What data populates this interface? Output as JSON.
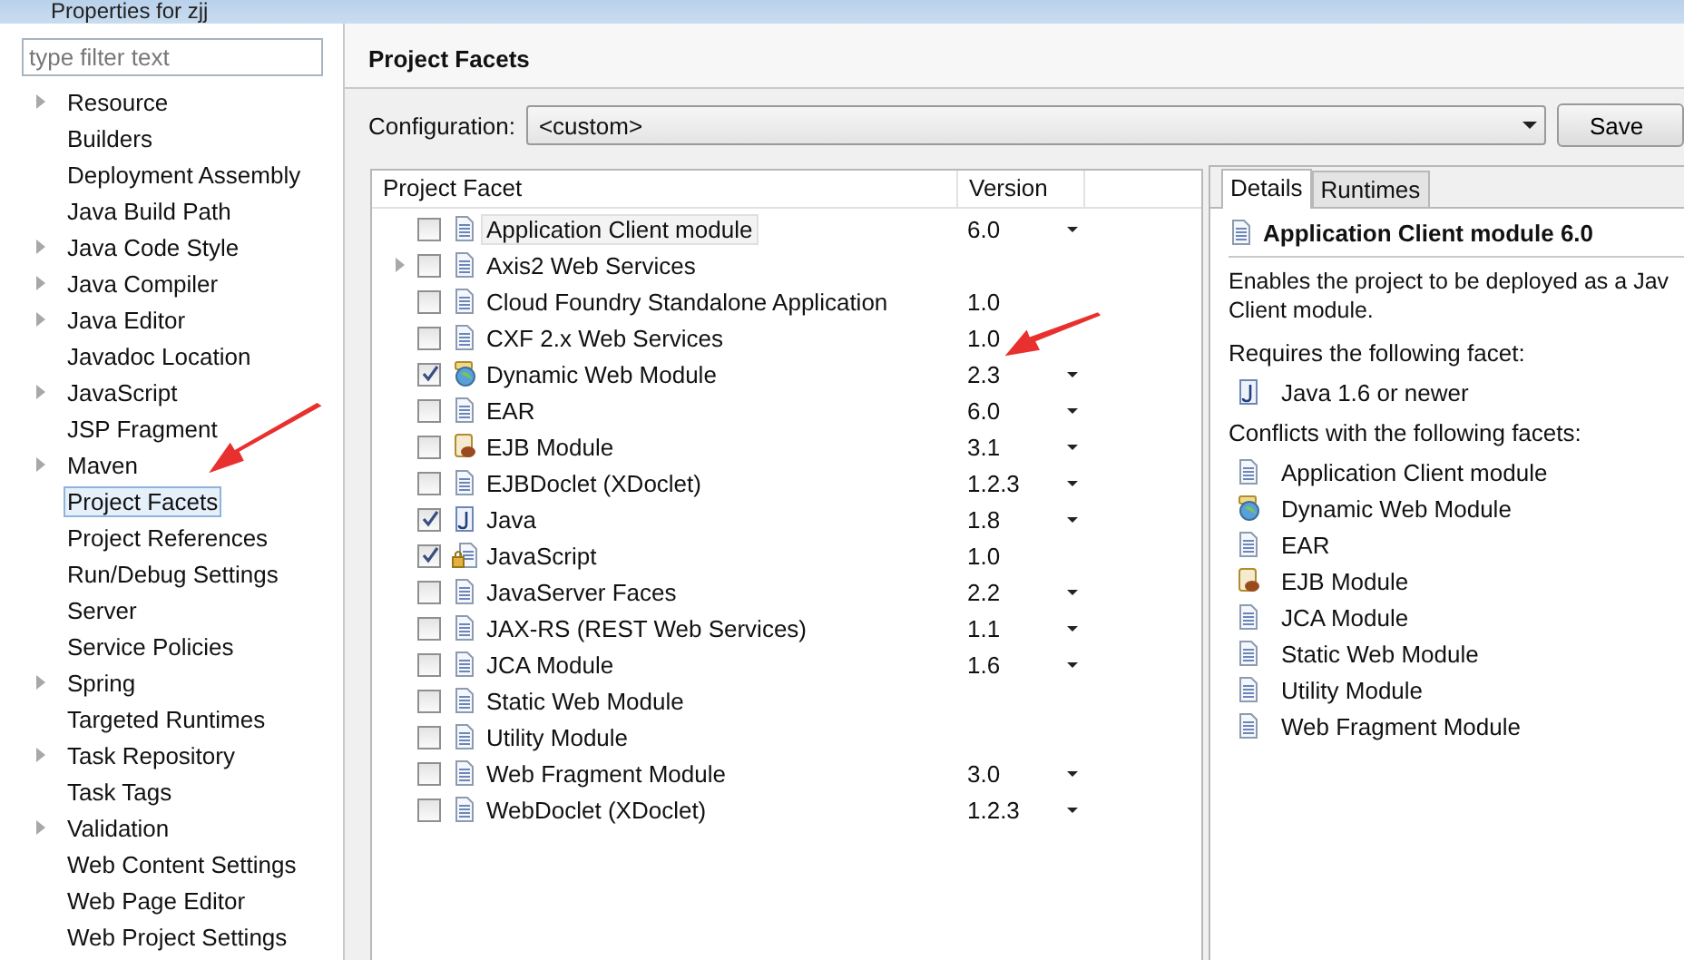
{
  "window": {
    "title": "Properties for zjj"
  },
  "sidebar": {
    "filter": {
      "placeholder": "type filter text"
    },
    "items": [
      {
        "label": "Resource",
        "expandable": true,
        "selected": false
      },
      {
        "label": "Builders",
        "expandable": false,
        "selected": false
      },
      {
        "label": "Deployment Assembly",
        "expandable": false,
        "selected": false
      },
      {
        "label": "Java Build Path",
        "expandable": false,
        "selected": false
      },
      {
        "label": "Java Code Style",
        "expandable": true,
        "selected": false
      },
      {
        "label": "Java Compiler",
        "expandable": true,
        "selected": false
      },
      {
        "label": "Java Editor",
        "expandable": true,
        "selected": false
      },
      {
        "label": "Javadoc Location",
        "expandable": false,
        "selected": false
      },
      {
        "label": "JavaScript",
        "expandable": true,
        "selected": false
      },
      {
        "label": "JSP Fragment",
        "expandable": false,
        "selected": false
      },
      {
        "label": "Maven",
        "expandable": true,
        "selected": false
      },
      {
        "label": "Project Facets",
        "expandable": false,
        "selected": true
      },
      {
        "label": "Project References",
        "expandable": false,
        "selected": false
      },
      {
        "label": "Run/Debug Settings",
        "expandable": false,
        "selected": false
      },
      {
        "label": "Server",
        "expandable": false,
        "selected": false
      },
      {
        "label": "Service Policies",
        "expandable": false,
        "selected": false
      },
      {
        "label": "Spring",
        "expandable": true,
        "selected": false
      },
      {
        "label": "Targeted Runtimes",
        "expandable": false,
        "selected": false
      },
      {
        "label": "Task Repository",
        "expandable": true,
        "selected": false
      },
      {
        "label": "Task Tags",
        "expandable": false,
        "selected": false
      },
      {
        "label": "Validation",
        "expandable": true,
        "selected": false
      },
      {
        "label": "Web Content Settings",
        "expandable": false,
        "selected": false
      },
      {
        "label": "Web Page Editor",
        "expandable": false,
        "selected": false
      },
      {
        "label": "Web Project Settings",
        "expandable": false,
        "selected": false
      }
    ]
  },
  "page": {
    "title": "Project Facets",
    "configuration": {
      "label": "Configuration:",
      "value": "<custom>"
    },
    "save_button": "Save"
  },
  "facets": {
    "columns": [
      "Project Facet",
      "Version"
    ],
    "rows": [
      {
        "name": "Application Client module",
        "version": "6.0",
        "has_menu": true,
        "checked": false,
        "selected": true,
        "expandable": false,
        "kind": "doc"
      },
      {
        "name": "Axis2 Web Services",
        "has_menu": false,
        "checked": false,
        "selected": false,
        "expandable": true,
        "kind": "doc"
      },
      {
        "name": "Cloud Foundry Standalone Application",
        "version": "1.0",
        "has_menu": false,
        "checked": false,
        "selected": false,
        "expandable": false,
        "kind": "doc"
      },
      {
        "name": "CXF 2.x Web Services",
        "version": "1.0",
        "has_menu": false,
        "checked": false,
        "selected": false,
        "expandable": false,
        "kind": "doc"
      },
      {
        "name": "Dynamic Web Module",
        "version": "2.3",
        "has_menu": true,
        "checked": true,
        "selected": false,
        "expandable": false,
        "kind": "web"
      },
      {
        "name": "EAR",
        "version": "6.0",
        "has_menu": true,
        "checked": false,
        "selected": false,
        "expandable": false,
        "kind": "doc"
      },
      {
        "name": "EJB Module",
        "version": "3.1",
        "has_menu": true,
        "checked": false,
        "selected": false,
        "expandable": false,
        "kind": "ejb"
      },
      {
        "name": "EJBDoclet (XDoclet)",
        "version": "1.2.3",
        "has_menu": true,
        "checked": false,
        "selected": false,
        "expandable": false,
        "kind": "doc"
      },
      {
        "name": "Java",
        "version": "1.8",
        "has_menu": true,
        "checked": true,
        "selected": false,
        "expandable": false,
        "kind": "java"
      },
      {
        "name": "JavaScript",
        "version": "1.0",
        "has_menu": false,
        "checked": true,
        "selected": false,
        "expandable": false,
        "kind": "locked"
      },
      {
        "name": "JavaServer Faces",
        "version": "2.2",
        "has_menu": true,
        "checked": false,
        "selected": false,
        "expandable": false,
        "kind": "doc"
      },
      {
        "name": "JAX-RS (REST Web Services)",
        "version": "1.1",
        "has_menu": true,
        "checked": false,
        "selected": false,
        "expandable": false,
        "kind": "doc"
      },
      {
        "name": "JCA Module",
        "version": "1.6",
        "has_menu": true,
        "checked": false,
        "selected": false,
        "expandable": false,
        "kind": "doc"
      },
      {
        "name": "Static Web Module",
        "has_menu": false,
        "checked": false,
        "selected": false,
        "expandable": false,
        "kind": "doc"
      },
      {
        "name": "Utility Module",
        "has_menu": false,
        "checked": false,
        "selected": false,
        "expandable": false,
        "kind": "doc"
      },
      {
        "name": "Web Fragment Module",
        "version": "3.0",
        "has_menu": true,
        "checked": false,
        "selected": false,
        "expandable": false,
        "kind": "doc"
      },
      {
        "name": "WebDoclet (XDoclet)",
        "version": "1.2.3",
        "has_menu": true,
        "checked": false,
        "selected": false,
        "expandable": false,
        "kind": "doc"
      }
    ]
  },
  "details": {
    "tabs": [
      {
        "label": "Details",
        "selected": true
      },
      {
        "label": "Runtimes",
        "selected": false
      }
    ],
    "title": "Application Client module 6.0",
    "description": [
      "Enables the project to be deployed as a Jav",
      "Client module."
    ],
    "requires_heading": "Requires the following facet:",
    "requires": [
      {
        "label": "Java 1.6 or newer",
        "kind": "java"
      }
    ],
    "conflicts_heading": "Conflicts with the following facets:",
    "conflicts": [
      {
        "label": "Application Client module",
        "kind": "doc"
      },
      {
        "label": "Dynamic Web Module",
        "kind": "web"
      },
      {
        "label": "EAR",
        "kind": "doc"
      },
      {
        "label": "EJB Module",
        "kind": "ejb"
      },
      {
        "label": "JCA Module",
        "kind": "doc"
      },
      {
        "label": "Static Web Module",
        "kind": "doc"
      },
      {
        "label": "Utility Module",
        "kind": "doc"
      },
      {
        "label": "Web Fragment Module",
        "kind": "doc"
      }
    ]
  }
}
